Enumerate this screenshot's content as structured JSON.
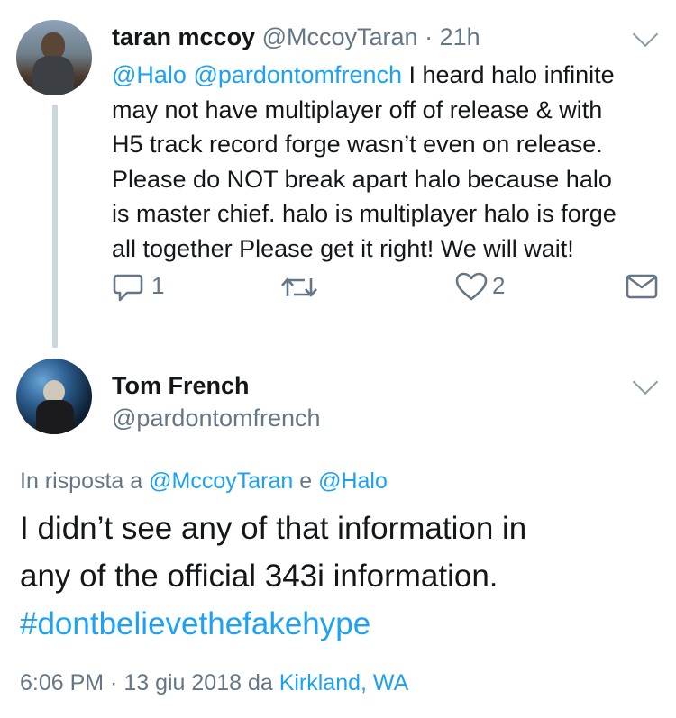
{
  "tweet1": {
    "display_name": "taran mccoy",
    "handle": "@MccoyTaran",
    "separator": "·",
    "time": "21h",
    "mention1": "@Halo",
    "mention2": "@pardontomfrench",
    "text_line1": " I heard halo infinite",
    "text_line2": "may not have multiplayer off of release & with",
    "text_line3": "H5 track record forge wasn’t even on release.",
    "text_line4": "Please do NOT break apart halo because halo",
    "text_line5": "is master chief. halo is multiplayer halo is forge",
    "text_line6": "all together Please get it right! We will wait!",
    "reply_count": "1",
    "like_count": "2"
  },
  "tweet2": {
    "display_name": "Tom French",
    "handle": "@pardontomfrench",
    "reply_prefix": "In risposta a ",
    "reply_user1": "@MccoyTaran",
    "reply_and": " e ",
    "reply_user2": "@Halo",
    "text_line1": "I didn’t see any of that information in",
    "text_line2": "any of the official 343i information.",
    "hashtag": "#dontbelievethefakehype",
    "meta_time": "6:06 PM · 13 giu 2018 da ",
    "location": "Kirkland, WA"
  },
  "icons": {
    "reply": "reply-icon",
    "retweet": "retweet-icon",
    "like": "heart-icon",
    "dm": "envelope-icon",
    "menu": "chevron-down-icon"
  },
  "colors": {
    "link": "#1da1f2",
    "muted": "#657786",
    "text": "#14171a",
    "thread_line": "#ccd6dd"
  }
}
